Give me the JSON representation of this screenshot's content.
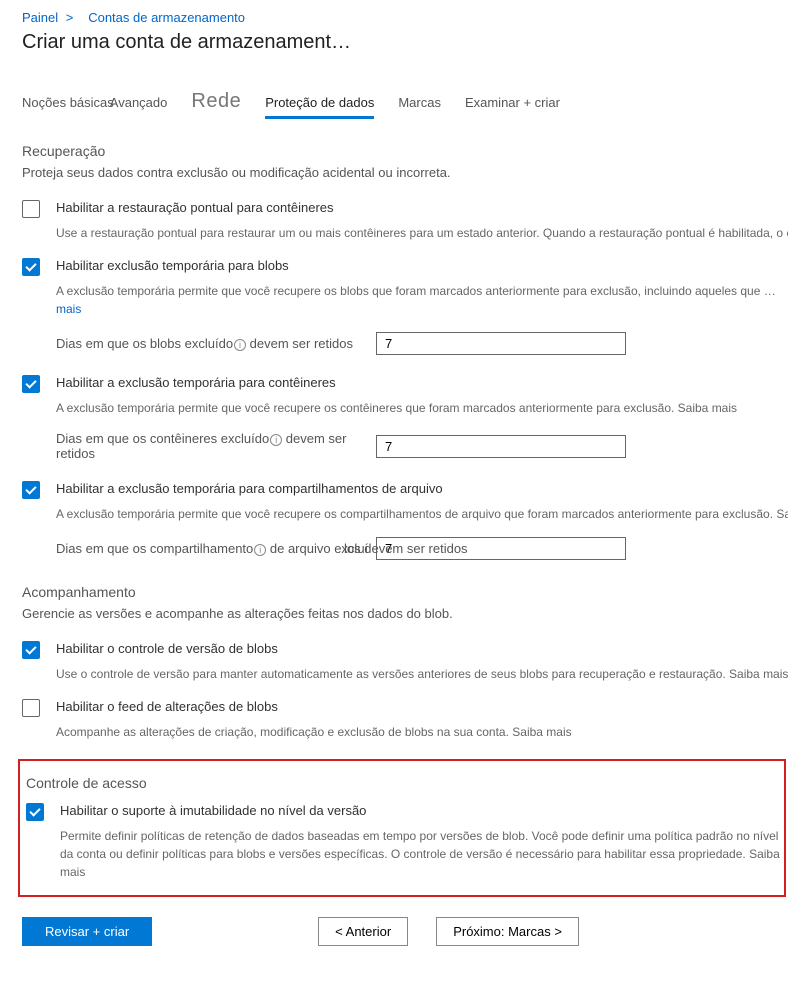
{
  "breadcrumb": {
    "root": "Painel",
    "current": "Contas de armazenamento"
  },
  "page_title": "Criar uma conta de armazenament…",
  "tabs": {
    "basics": "Noções básicas",
    "advanced": "Avançado",
    "network": "Rede",
    "data_protection": "Proteção de dados",
    "tags": "Marcas",
    "review": "Examinar + criar"
  },
  "recovery": {
    "title": "Recuperação",
    "desc": "Proteja seus dados contra exclusão ou modificação acidental ou incorreta.",
    "pitr": {
      "label": "Habilitar a restauração pontual para contêineres",
      "desc": "Use a restauração pontual para restaurar um ou mais contêineres para um estado anterior. Quando a restauração pontual é habilitada, o controle de versão, o feed de alterações e a exclusão reversível de blob também precisam ser habilitados. Saiba mais",
      "checked": false
    },
    "blob_softdelete": {
      "label": "Habilitar exclusão temporária para blobs",
      "desc_pre": "A exclusão temporária permite que você recupere os blobs que foram marcados anteriormente para exclusão, incluindo aqueles que … ",
      "desc_link": "mais",
      "days_label_a": "Dias em que os blobs excluído",
      "days_label_b": " devem ser retidos",
      "days": "7",
      "checked": true
    },
    "container_softdelete": {
      "label": "Habilitar a exclusão temporária para contêineres",
      "desc": "A exclusão temporária permite que você recupere os contêineres que foram marcados anteriormente para exclusão. Saiba mais",
      "days_label_a": "Dias em que os contêineres excluído",
      "days_label_b": " devem ser retidos",
      "days": "7",
      "checked": true
    },
    "share_softdelete": {
      "label": "Habilitar a exclusão temporária para compartilhamentos de arquivo",
      "desc": "A exclusão temporária permite que você recupere os compartilhamentos de arquivo que foram marcados anteriormente para exclusão. Saiba mais",
      "days_label_a": "Dias em que os compartilhamento",
      "days_label_b": " de arquivo excluí",
      "days_label_c": " los devem ser retidos",
      "days": "7",
      "checked": true
    }
  },
  "tracking": {
    "title": "Acompanhamento",
    "desc": "Gerencie as versões e acompanhe as alterações feitas nos dados do blob.",
    "versioning": {
      "label": "Habilitar o controle de versão de blobs",
      "desc": "Use o controle de versão para manter automaticamente as versões anteriores de seus blobs para recuperação e restauração. Saiba mais",
      "checked": true
    },
    "changefeed": {
      "label": "Habilitar o feed de alterações de blobs",
      "desc": "Acompanhe as alterações de criação, modificação e exclusão de blobs na sua conta. Saiba mais",
      "checked": false
    }
  },
  "access": {
    "title": "Controle de acesso",
    "immutability": {
      "label": "Habilitar o suporte à imutabilidade no nível da versão",
      "desc": "Permite definir políticas de retenção de dados baseadas em tempo por versões de blob. Você pode definir uma política padrão no nível da conta ou definir políticas para blobs e versões específicas. O controle de versão é necessário para habilitar essa propriedade. Saiba mais",
      "checked": true
    }
  },
  "footer": {
    "review": "Revisar + criar",
    "prev": "<  Anterior",
    "next": "Próximo: Marcas >"
  }
}
